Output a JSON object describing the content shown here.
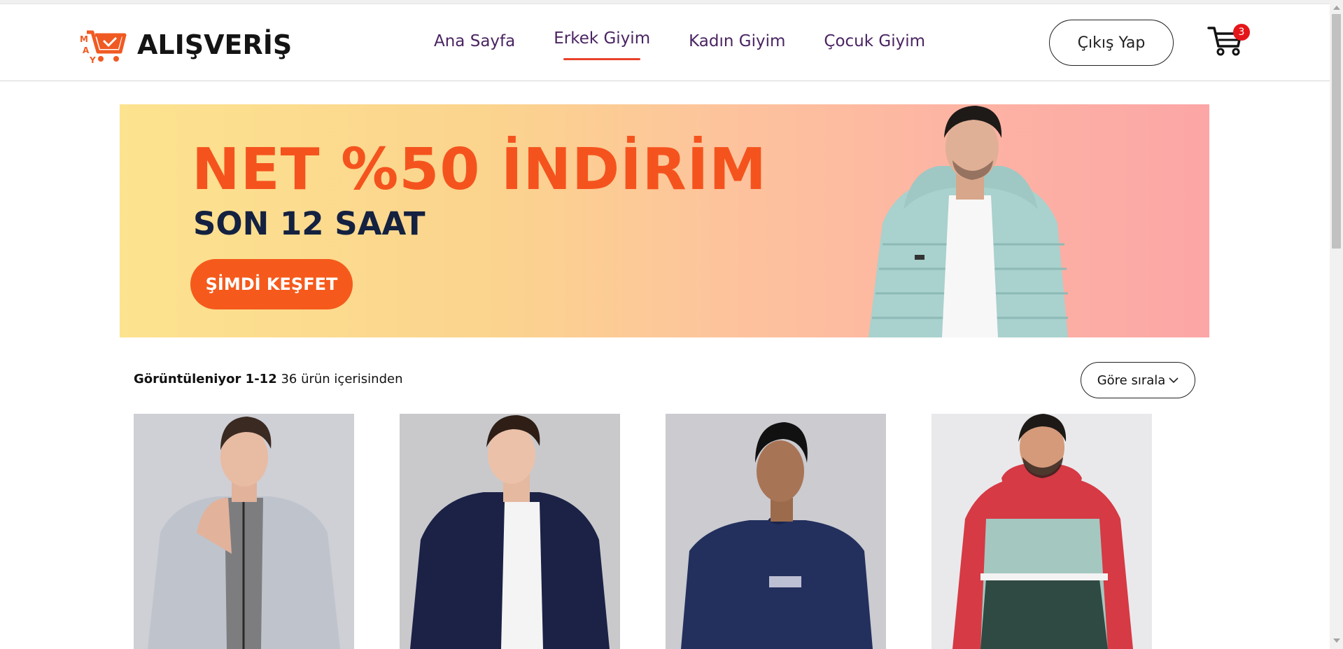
{
  "header": {
    "logo_text": "ALIŞVERİŞ",
    "logo_letters": [
      "M",
      "A",
      "Y"
    ],
    "nav": [
      {
        "label": "Ana Sayfa",
        "active": false
      },
      {
        "label": "Erkek Giyim",
        "active": true
      },
      {
        "label": "Kadın Giyim",
        "active": false
      },
      {
        "label": "Çocuk Giyim",
        "active": false
      }
    ],
    "logout_label": "Çıkış Yap",
    "cart_count": "3"
  },
  "banner": {
    "headline": "NET %50 İNDİRİM",
    "subline": "SON 12 SAAT",
    "cta": "ŞİMDİ KEŞFET"
  },
  "listing": {
    "showing_label": "Görüntüleniyor 1-12",
    "total_label": "36 ürün içerisinden",
    "sort_label": "Göre sırala"
  },
  "colors": {
    "brand_orange": "#f5531e",
    "nav_text": "#4a2462",
    "active_underline": "#e8432d",
    "badge": "#e5161a"
  },
  "products": [
    {
      "name": "grey-zip-jacket",
      "bg": "#cfcfd6"
    },
    {
      "name": "navy-fleece-jacket",
      "bg": "#c9c9cc"
    },
    {
      "name": "navy-sweatshirt",
      "bg": "#cbcbd0"
    },
    {
      "name": "colorblock-windbreaker",
      "bg": "#e9e9ec"
    }
  ]
}
